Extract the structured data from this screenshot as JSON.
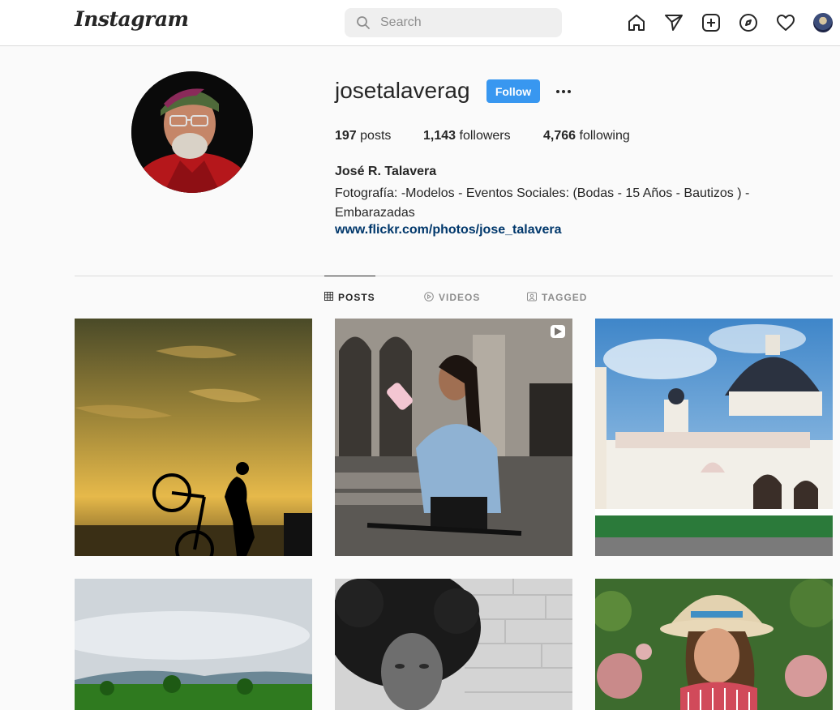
{
  "header": {
    "logo": "Instagram",
    "search_placeholder": "Search",
    "nav_icons": [
      "home-icon",
      "direct-icon",
      "new-post-icon",
      "explore-icon",
      "activity-icon",
      "profile-avatar"
    ]
  },
  "profile": {
    "username": "josetalaverag",
    "follow_label": "Follow",
    "stats": {
      "posts_count": "197",
      "posts_label": "posts",
      "followers_count": "1,143",
      "followers_label": "followers",
      "following_count": "4,766",
      "following_label": "following"
    },
    "full_name": "José R. Talavera",
    "bio_line1": "Fotografía: -Modelos - Eventos Sociales: (Bodas - 15 Años - Bautizos ) -",
    "bio_line2": "Embarazadas",
    "link": "www.flickr.com/photos/jose_talavera"
  },
  "tabs": [
    {
      "label": "POSTS",
      "icon": "grid-icon",
      "active": true
    },
    {
      "label": "VIDEOS",
      "icon": "play-circle-icon",
      "active": false
    },
    {
      "label": "TAGGED",
      "icon": "tag-icon",
      "active": false
    }
  ],
  "posts": [
    {
      "name": "post-sunset-cyclist",
      "is_video": false
    },
    {
      "name": "post-woman-drinking-bike",
      "is_video": true
    },
    {
      "name": "post-church",
      "is_video": false
    },
    {
      "name": "post-landscape",
      "is_video": false
    },
    {
      "name": "post-bw-portrait",
      "is_video": false
    },
    {
      "name": "post-woman-hat",
      "is_video": false
    }
  ],
  "colors": {
    "accent": "#3897f0",
    "link": "#00376b",
    "text": "#262626",
    "muted": "#8e8e8e",
    "background": "#fafafa"
  }
}
